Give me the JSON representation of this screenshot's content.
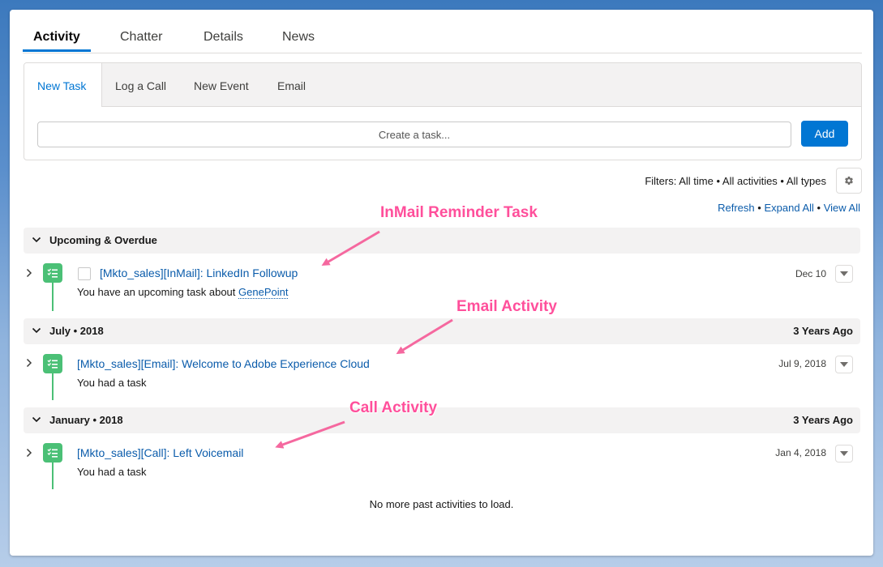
{
  "tabs": [
    "Activity",
    "Chatter",
    "Details",
    "News"
  ],
  "composer": {
    "tabs": [
      "New Task",
      "Log a Call",
      "New Event",
      "Email"
    ],
    "input_placeholder": "Create a task...",
    "add_label": "Add"
  },
  "filters": {
    "text": "Filters: All time • All activities • All types",
    "refresh": "Refresh",
    "expand_all": "Expand All",
    "view_all": "View All",
    "separator": "•"
  },
  "sections": [
    {
      "title": "Upcoming & Overdue",
      "right": "",
      "items": [
        {
          "title": "[Mkto_sales][InMail]: LinkedIn Followup",
          "subtitle": "You have an upcoming task about",
          "subtitle_link": "GenePoint",
          "date": "Dec 10"
        }
      ]
    },
    {
      "title": "July • 2018",
      "right": "3 Years Ago",
      "items": [
        {
          "title": "[Mkto_sales][Email]: Welcome to Adobe Experience Cloud",
          "subtitle": "You had a task",
          "date": "Jul 9, 2018"
        }
      ]
    },
    {
      "title": "January • 2018",
      "right": "3 Years Ago",
      "items": [
        {
          "title": "[Mkto_sales][Call]: Left Voicemail",
          "subtitle": "You had a task",
          "date": "Jan 4, 2018"
        }
      ]
    }
  ],
  "no_more": "No more past activities to load.",
  "annotations": [
    "InMail Reminder Task",
    "Email Activity",
    "Call Activity"
  ],
  "colors": {
    "accent": "#0176d3",
    "task_icon": "#4bc076",
    "annotation": "#ff4f9b"
  },
  "icons": [
    "task-icon",
    "gear-icon",
    "chevron-down-icon",
    "chevron-right-icon",
    "dropdown-icon"
  ]
}
